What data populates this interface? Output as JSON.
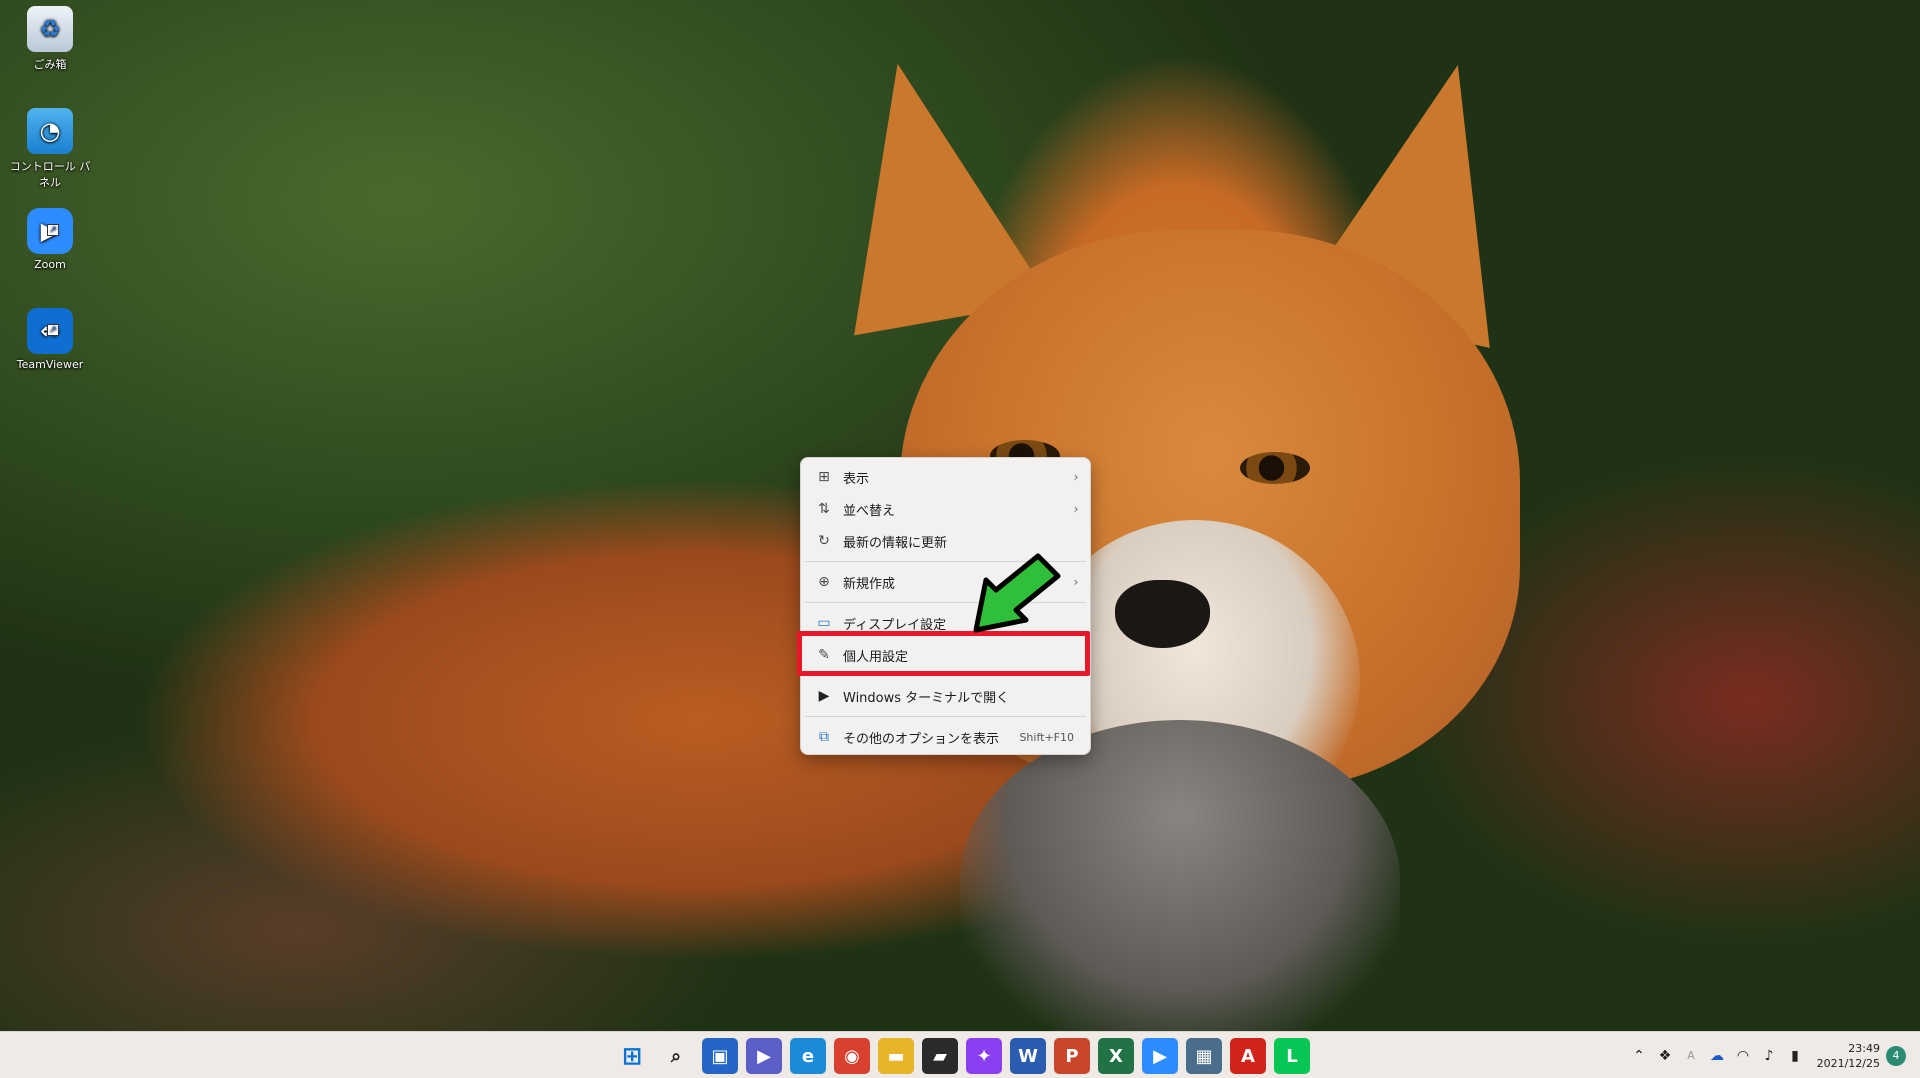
{
  "desktop": {
    "icons": [
      {
        "label": "ごみ箱",
        "icon": "recycle-bin-icon"
      },
      {
        "label": "コントロール パネル",
        "icon": "control-panel-icon"
      },
      {
        "label": "Zoom",
        "icon": "zoom-icon"
      },
      {
        "label": "TeamViewer",
        "icon": "teamviewer-icon"
      }
    ]
  },
  "context_menu": {
    "items": [
      {
        "label": "表示",
        "icon": "grid-icon",
        "submenu": true
      },
      {
        "label": "並べ替え",
        "icon": "sort-icon",
        "submenu": true
      },
      {
        "label": "最新の情報に更新",
        "icon": "refresh-icon",
        "submenu": false
      },
      {
        "label": "新規作成",
        "icon": "plus-circle-icon",
        "submenu": true
      },
      {
        "label": "ディスプレイ設定",
        "icon": "display-icon",
        "submenu": false
      },
      {
        "label": "個人用設定",
        "icon": "brush-icon",
        "submenu": false,
        "highlighted": true
      },
      {
        "label": "Windows ターミナルで開く",
        "icon": "terminal-icon",
        "submenu": false
      },
      {
        "label": "その他のオプションを表示",
        "icon": "more-options-icon",
        "submenu": false,
        "shortcut": "Shift+F10"
      }
    ],
    "highlight_color": "#e8182b"
  },
  "annotation": {
    "arrow_color": "#2fbf3a"
  },
  "taskbar": {
    "apps": [
      {
        "name": "start-button",
        "glyph": "⊞",
        "color": "#0a74d6"
      },
      {
        "name": "search-button",
        "glyph": "⌕",
        "color": "#222222"
      },
      {
        "name": "task-view-button",
        "glyph": "▣",
        "color": "#2366c8"
      },
      {
        "name": "chat-button",
        "glyph": "▶",
        "color": "#5b5fc7"
      },
      {
        "name": "edge-button",
        "glyph": "e",
        "color": "#1b8ad8"
      },
      {
        "name": "chrome-button",
        "glyph": "◉",
        "color": "#d9412f"
      },
      {
        "name": "file-explorer-button",
        "glyph": "▬",
        "color": "#e8b52a"
      },
      {
        "name": "sticky-notes-button",
        "glyph": "▰",
        "color": "#2b2b2b"
      },
      {
        "name": "messenger-button",
        "glyph": "✦",
        "color": "#8a3ff0"
      },
      {
        "name": "word-button",
        "glyph": "W",
        "color": "#2b5cb0"
      },
      {
        "name": "powerpoint-button",
        "glyph": "P",
        "color": "#c9462a"
      },
      {
        "name": "excel-button",
        "glyph": "X",
        "color": "#217346"
      },
      {
        "name": "zoom-button",
        "glyph": "▶",
        "color": "#2d8cff"
      },
      {
        "name": "calculator-button",
        "glyph": "▦",
        "color": "#4a6d8c"
      },
      {
        "name": "acrobat-button",
        "glyph": "A",
        "color": "#d3241b"
      },
      {
        "name": "line-button",
        "glyph": "L",
        "color": "#06c755"
      }
    ],
    "tray": {
      "time": "23:49",
      "date": "2021/12/25",
      "notification_count": "4",
      "ime": "A"
    }
  }
}
